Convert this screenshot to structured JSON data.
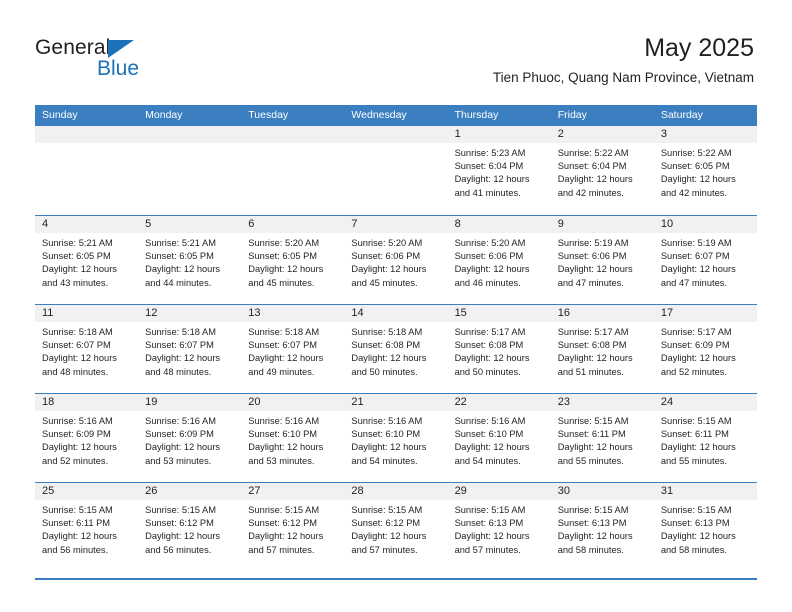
{
  "brand": {
    "name_top": "General",
    "name_bottom": "Blue",
    "accent_color": "#1b72b8",
    "triangle_icon": "triangle-icon"
  },
  "header": {
    "title": "May 2025",
    "subtitle": "Tien Phuoc, Quang Nam Province, Vietnam"
  },
  "theme": {
    "header_bar": "#3c7fc1",
    "daynum_band": "#f1f1f1",
    "text": "#231f20",
    "rule": "#3c7fc1"
  },
  "calendar": {
    "day_headers": [
      "Sunday",
      "Monday",
      "Tuesday",
      "Wednesday",
      "Thursday",
      "Friday",
      "Saturday"
    ],
    "weeks": [
      [
        {
          "day": "",
          "sunrise": "",
          "sunset": "",
          "daylight1": "",
          "daylight2": ""
        },
        {
          "day": "",
          "sunrise": "",
          "sunset": "",
          "daylight1": "",
          "daylight2": ""
        },
        {
          "day": "",
          "sunrise": "",
          "sunset": "",
          "daylight1": "",
          "daylight2": ""
        },
        {
          "day": "",
          "sunrise": "",
          "sunset": "",
          "daylight1": "",
          "daylight2": ""
        },
        {
          "day": "1",
          "sunrise": "Sunrise: 5:23 AM",
          "sunset": "Sunset: 6:04 PM",
          "daylight1": "Daylight: 12 hours",
          "daylight2": "and 41 minutes."
        },
        {
          "day": "2",
          "sunrise": "Sunrise: 5:22 AM",
          "sunset": "Sunset: 6:04 PM",
          "daylight1": "Daylight: 12 hours",
          "daylight2": "and 42 minutes."
        },
        {
          "day": "3",
          "sunrise": "Sunrise: 5:22 AM",
          "sunset": "Sunset: 6:05 PM",
          "daylight1": "Daylight: 12 hours",
          "daylight2": "and 42 minutes."
        }
      ],
      [
        {
          "day": "4",
          "sunrise": "Sunrise: 5:21 AM",
          "sunset": "Sunset: 6:05 PM",
          "daylight1": "Daylight: 12 hours",
          "daylight2": "and 43 minutes."
        },
        {
          "day": "5",
          "sunrise": "Sunrise: 5:21 AM",
          "sunset": "Sunset: 6:05 PM",
          "daylight1": "Daylight: 12 hours",
          "daylight2": "and 44 minutes."
        },
        {
          "day": "6",
          "sunrise": "Sunrise: 5:20 AM",
          "sunset": "Sunset: 6:05 PM",
          "daylight1": "Daylight: 12 hours",
          "daylight2": "and 45 minutes."
        },
        {
          "day": "7",
          "sunrise": "Sunrise: 5:20 AM",
          "sunset": "Sunset: 6:06 PM",
          "daylight1": "Daylight: 12 hours",
          "daylight2": "and 45 minutes."
        },
        {
          "day": "8",
          "sunrise": "Sunrise: 5:20 AM",
          "sunset": "Sunset: 6:06 PM",
          "daylight1": "Daylight: 12 hours",
          "daylight2": "and 46 minutes."
        },
        {
          "day": "9",
          "sunrise": "Sunrise: 5:19 AM",
          "sunset": "Sunset: 6:06 PM",
          "daylight1": "Daylight: 12 hours",
          "daylight2": "and 47 minutes."
        },
        {
          "day": "10",
          "sunrise": "Sunrise: 5:19 AM",
          "sunset": "Sunset: 6:07 PM",
          "daylight1": "Daylight: 12 hours",
          "daylight2": "and 47 minutes."
        }
      ],
      [
        {
          "day": "11",
          "sunrise": "Sunrise: 5:18 AM",
          "sunset": "Sunset: 6:07 PM",
          "daylight1": "Daylight: 12 hours",
          "daylight2": "and 48 minutes."
        },
        {
          "day": "12",
          "sunrise": "Sunrise: 5:18 AM",
          "sunset": "Sunset: 6:07 PM",
          "daylight1": "Daylight: 12 hours",
          "daylight2": "and 48 minutes."
        },
        {
          "day": "13",
          "sunrise": "Sunrise: 5:18 AM",
          "sunset": "Sunset: 6:07 PM",
          "daylight1": "Daylight: 12 hours",
          "daylight2": "and 49 minutes."
        },
        {
          "day": "14",
          "sunrise": "Sunrise: 5:18 AM",
          "sunset": "Sunset: 6:08 PM",
          "daylight1": "Daylight: 12 hours",
          "daylight2": "and 50 minutes."
        },
        {
          "day": "15",
          "sunrise": "Sunrise: 5:17 AM",
          "sunset": "Sunset: 6:08 PM",
          "daylight1": "Daylight: 12 hours",
          "daylight2": "and 50 minutes."
        },
        {
          "day": "16",
          "sunrise": "Sunrise: 5:17 AM",
          "sunset": "Sunset: 6:08 PM",
          "daylight1": "Daylight: 12 hours",
          "daylight2": "and 51 minutes."
        },
        {
          "day": "17",
          "sunrise": "Sunrise: 5:17 AM",
          "sunset": "Sunset: 6:09 PM",
          "daylight1": "Daylight: 12 hours",
          "daylight2": "and 52 minutes."
        }
      ],
      [
        {
          "day": "18",
          "sunrise": "Sunrise: 5:16 AM",
          "sunset": "Sunset: 6:09 PM",
          "daylight1": "Daylight: 12 hours",
          "daylight2": "and 52 minutes."
        },
        {
          "day": "19",
          "sunrise": "Sunrise: 5:16 AM",
          "sunset": "Sunset: 6:09 PM",
          "daylight1": "Daylight: 12 hours",
          "daylight2": "and 53 minutes."
        },
        {
          "day": "20",
          "sunrise": "Sunrise: 5:16 AM",
          "sunset": "Sunset: 6:10 PM",
          "daylight1": "Daylight: 12 hours",
          "daylight2": "and 53 minutes."
        },
        {
          "day": "21",
          "sunrise": "Sunrise: 5:16 AM",
          "sunset": "Sunset: 6:10 PM",
          "daylight1": "Daylight: 12 hours",
          "daylight2": "and 54 minutes."
        },
        {
          "day": "22",
          "sunrise": "Sunrise: 5:16 AM",
          "sunset": "Sunset: 6:10 PM",
          "daylight1": "Daylight: 12 hours",
          "daylight2": "and 54 minutes."
        },
        {
          "day": "23",
          "sunrise": "Sunrise: 5:15 AM",
          "sunset": "Sunset: 6:11 PM",
          "daylight1": "Daylight: 12 hours",
          "daylight2": "and 55 minutes."
        },
        {
          "day": "24",
          "sunrise": "Sunrise: 5:15 AM",
          "sunset": "Sunset: 6:11 PM",
          "daylight1": "Daylight: 12 hours",
          "daylight2": "and 55 minutes."
        }
      ],
      [
        {
          "day": "25",
          "sunrise": "Sunrise: 5:15 AM",
          "sunset": "Sunset: 6:11 PM",
          "daylight1": "Daylight: 12 hours",
          "daylight2": "and 56 minutes."
        },
        {
          "day": "26",
          "sunrise": "Sunrise: 5:15 AM",
          "sunset": "Sunset: 6:12 PM",
          "daylight1": "Daylight: 12 hours",
          "daylight2": "and 56 minutes."
        },
        {
          "day": "27",
          "sunrise": "Sunrise: 5:15 AM",
          "sunset": "Sunset: 6:12 PM",
          "daylight1": "Daylight: 12 hours",
          "daylight2": "and 57 minutes."
        },
        {
          "day": "28",
          "sunrise": "Sunrise: 5:15 AM",
          "sunset": "Sunset: 6:12 PM",
          "daylight1": "Daylight: 12 hours",
          "daylight2": "and 57 minutes."
        },
        {
          "day": "29",
          "sunrise": "Sunrise: 5:15 AM",
          "sunset": "Sunset: 6:13 PM",
          "daylight1": "Daylight: 12 hours",
          "daylight2": "and 57 minutes."
        },
        {
          "day": "30",
          "sunrise": "Sunrise: 5:15 AM",
          "sunset": "Sunset: 6:13 PM",
          "daylight1": "Daylight: 12 hours",
          "daylight2": "and 58 minutes."
        },
        {
          "day": "31",
          "sunrise": "Sunrise: 5:15 AM",
          "sunset": "Sunset: 6:13 PM",
          "daylight1": "Daylight: 12 hours",
          "daylight2": "and 58 minutes."
        }
      ]
    ]
  }
}
